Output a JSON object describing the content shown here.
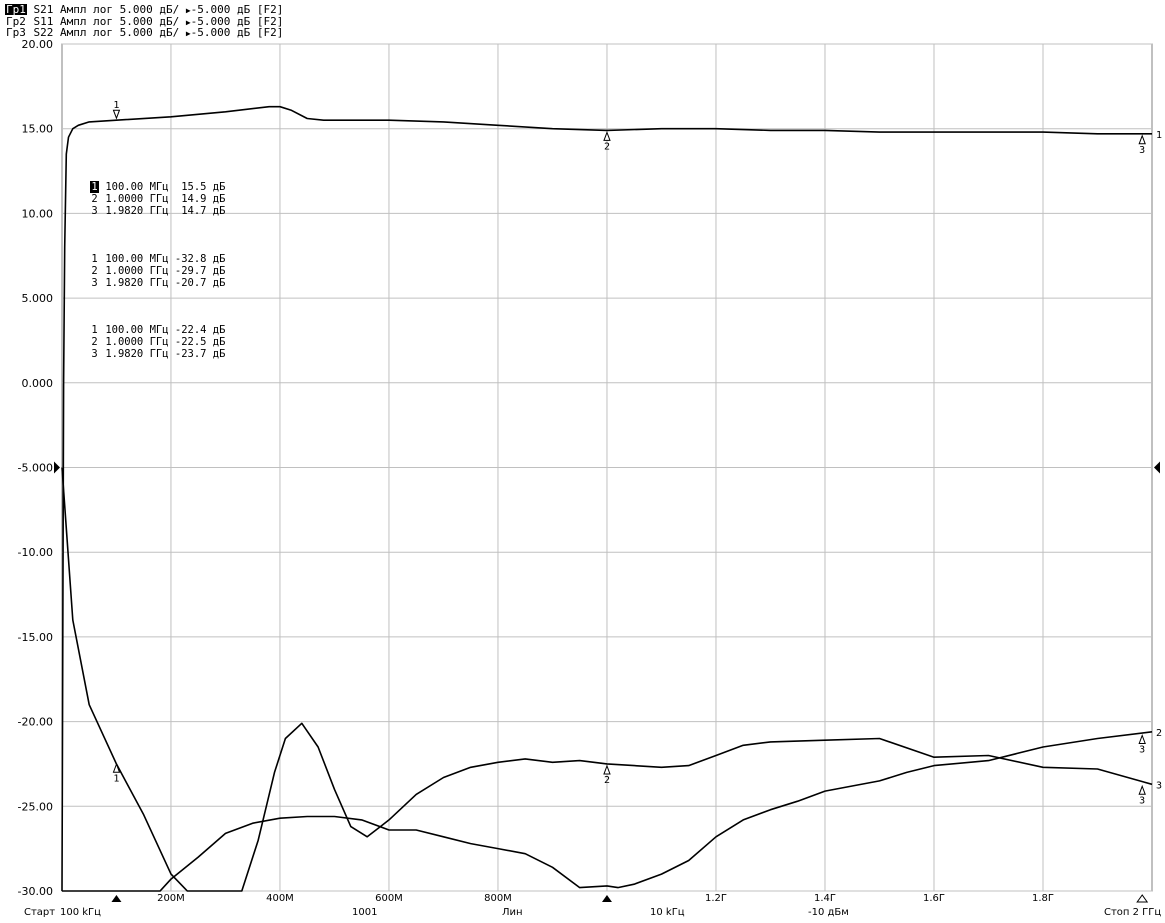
{
  "header": [
    {
      "tag": "Гр1",
      "param": "S21",
      "text": "Ампл лог 5.000 дБ/",
      "ref": "-5.000 дБ [F2]",
      "active": true
    },
    {
      "tag": "Гр2",
      "param": "S11",
      "text": "Ампл лог 5.000 дБ/",
      "ref": "-5.000 дБ [F2]",
      "active": false
    },
    {
      "tag": "Гр3",
      "param": "S22",
      "text": "Ампл лог 5.000 дБ/",
      "ref": "-5.000 дБ [F2]",
      "active": false
    }
  ],
  "marker_tables": [
    {
      "rows": [
        {
          "num": "1",
          "freq": "100.00 МГц",
          "value": " 15.5 дБ",
          "active": true
        },
        {
          "num": "2",
          "freq": "1.0000 ГГц",
          "value": " 14.9 дБ",
          "active": false
        },
        {
          "num": "3",
          "freq": "1.9820 ГГц",
          "value": " 14.7 дБ",
          "active": false
        }
      ]
    },
    {
      "rows": [
        {
          "num": "1",
          "freq": "100.00 МГц",
          "value": "-32.8 дБ",
          "active": false
        },
        {
          "num": "2",
          "freq": "1.0000 ГГц",
          "value": "-29.7 дБ",
          "active": false
        },
        {
          "num": "3",
          "freq": "1.9820 ГГц",
          "value": "-20.7 дБ",
          "active": false
        }
      ]
    },
    {
      "rows": [
        {
          "num": "1",
          "freq": "100.00 МГц",
          "value": "-22.4 дБ",
          "active": false
        },
        {
          "num": "2",
          "freq": "1.0000 ГГц",
          "value": "-22.5 дБ",
          "active": false
        },
        {
          "num": "3",
          "freq": "1.9820 ГГц",
          "value": "-23.7 дБ",
          "active": false
        }
      ]
    }
  ],
  "footer": {
    "start_label": "Старт",
    "start_value": "100 kГц",
    "points": "1001",
    "sweep": "Лин",
    "ifbw": "10 kГц",
    "power": "-10 дБм",
    "stop": "Стоп 2 ГГц"
  },
  "colors": {
    "background": "#ffffff",
    "grid": "#c0c0c0",
    "trace": "#000000"
  },
  "chart_data": {
    "type": "line",
    "xlim": [
      0.0001,
      2.0
    ],
    "ylim": [
      -30,
      20
    ],
    "x_ticks": [
      0.2,
      0.4,
      0.6,
      0.8,
      1.0,
      1.2,
      1.4,
      1.6,
      1.8
    ],
    "x_tick_labels": [
      "200M",
      "400M",
      "600M",
      "800M",
      "",
      "1.2Г",
      "1.4Г",
      "1.6Г",
      "1.8Г"
    ],
    "y_ticks": [
      20,
      15,
      10,
      5,
      0,
      -5,
      -10,
      -15,
      -20,
      -25,
      -30
    ],
    "y_tick_labels": [
      "20.00",
      "15.00",
      "10.00",
      "5.000",
      "0.000",
      "-5.000",
      "-10.00",
      "-15.00",
      "-20.00",
      "-25.00",
      "-30.00"
    ],
    "grid": true,
    "reference_level": -5,
    "series": [
      {
        "name": "S21",
        "end_label": "1",
        "x": [
          0.0001,
          0.003,
          0.005,
          0.008,
          0.012,
          0.02,
          0.03,
          0.05,
          0.1,
          0.2,
          0.3,
          0.38,
          0.4,
          0.42,
          0.45,
          0.48,
          0.55,
          0.6,
          0.7,
          0.8,
          0.9,
          1.0,
          1.1,
          1.2,
          1.3,
          1.4,
          1.5,
          1.6,
          1.7,
          1.8,
          1.9,
          2.0
        ],
        "y": [
          -30.0,
          0.0,
          8.0,
          13.5,
          14.5,
          15.0,
          15.2,
          15.4,
          15.5,
          15.7,
          16.0,
          16.3,
          16.3,
          16.1,
          15.6,
          15.5,
          15.5,
          15.5,
          15.4,
          15.2,
          15.0,
          14.9,
          15.0,
          15.0,
          14.9,
          14.9,
          14.8,
          14.8,
          14.8,
          14.8,
          14.7,
          14.7
        ]
      },
      {
        "name": "S11",
        "end_label": "2",
        "x": [
          0.0001,
          0.1,
          0.18,
          0.2,
          0.25,
          0.3,
          0.35,
          0.4,
          0.45,
          0.5,
          0.55,
          0.6,
          0.65,
          0.7,
          0.75,
          0.8,
          0.85,
          0.9,
          0.95,
          1.0,
          1.02,
          1.05,
          1.1,
          1.15,
          1.2,
          1.25,
          1.3,
          1.35,
          1.4,
          1.45,
          1.5,
          1.55,
          1.6,
          1.7,
          1.8,
          1.9,
          2.0
        ],
        "y": [
          -30.0,
          -30.0,
          -30.0,
          -29.3,
          -28.0,
          -26.6,
          -26.0,
          -25.7,
          -25.6,
          -25.6,
          -25.8,
          -26.4,
          -26.4,
          -26.8,
          -27.2,
          -27.5,
          -27.8,
          -28.6,
          -29.8,
          -29.7,
          -29.8,
          -29.6,
          -29.0,
          -28.2,
          -26.8,
          -25.8,
          -25.2,
          -24.7,
          -24.1,
          -23.8,
          -23.5,
          -23.0,
          -22.6,
          -22.3,
          -21.5,
          -21.0,
          -20.6
        ]
      },
      {
        "name": "S22",
        "end_label": "3",
        "x": [
          0.0001,
          0.02,
          0.05,
          0.1,
          0.15,
          0.2,
          0.23,
          0.25,
          0.3,
          0.33,
          0.36,
          0.39,
          0.41,
          0.44,
          0.47,
          0.5,
          0.53,
          0.56,
          0.6,
          0.65,
          0.7,
          0.75,
          0.8,
          0.85,
          0.9,
          0.95,
          1.0,
          1.05,
          1.1,
          1.15,
          1.2,
          1.25,
          1.3,
          1.4,
          1.5,
          1.6,
          1.7,
          1.8,
          1.9,
          2.0
        ],
        "y": [
          -5.0,
          -14.0,
          -19.0,
          -22.5,
          -25.5,
          -29.0,
          -30.0,
          -30.0,
          -30.0,
          -30.0,
          -27.0,
          -23.0,
          -21.0,
          -20.1,
          -21.5,
          -24.0,
          -26.2,
          -26.8,
          -25.8,
          -24.3,
          -23.3,
          -22.7,
          -22.4,
          -22.2,
          -22.4,
          -22.3,
          -22.5,
          -22.6,
          -22.7,
          -22.6,
          -22.0,
          -21.4,
          -21.2,
          -21.1,
          -21.0,
          -22.1,
          -22.0,
          -22.7,
          -22.8,
          -23.7
        ]
      }
    ],
    "markers": [
      {
        "label": "1",
        "x": 0.1,
        "y": 15.5,
        "series": "S21",
        "type": "down"
      },
      {
        "label": "2",
        "x": 1.0,
        "y": 14.9,
        "series": "S21",
        "type": "up"
      },
      {
        "label": "3",
        "x": 1.982,
        "y": 14.7,
        "series": "S21",
        "type": "up"
      },
      {
        "label": "1",
        "x": 0.1,
        "y": -22.4,
        "series": "S22",
        "type": "up"
      },
      {
        "label": "2",
        "x": 1.0,
        "y": -22.5,
        "series": "S22",
        "type": "up"
      },
      {
        "label": "3",
        "x": 1.982,
        "y": -20.7,
        "series": "S11",
        "type": "up"
      },
      {
        "label": "3",
        "x": 1.982,
        "y": -23.7,
        "series": "S22",
        "type": "up"
      }
    ]
  }
}
